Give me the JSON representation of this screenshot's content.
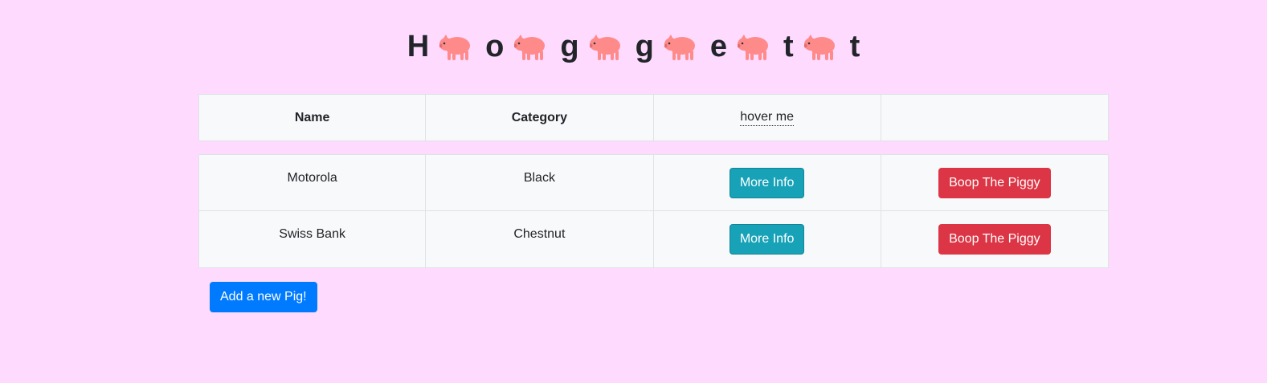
{
  "title": {
    "letters": [
      "H",
      "o",
      "g",
      "g",
      "e",
      "t",
      "t"
    ],
    "icon": "pig-icon",
    "pig_color": "#ff8a8a"
  },
  "table": {
    "headers": {
      "name": "Name",
      "category": "Category",
      "hover": "hover me",
      "actions": ""
    },
    "rows": [
      {
        "name": "Motorola",
        "category": "Black",
        "info_label": "More Info",
        "boop_label": "Boop The Piggy"
      },
      {
        "name": "Swiss Bank",
        "category": "Chestnut",
        "info_label": "More Info",
        "boop_label": "Boop The Piggy"
      }
    ]
  },
  "add_button": {
    "label": "Add a new Pig!"
  },
  "colors": {
    "background": "#ffdaff",
    "info": "#17a2b8",
    "danger": "#dc3545",
    "primary": "#007bff"
  }
}
